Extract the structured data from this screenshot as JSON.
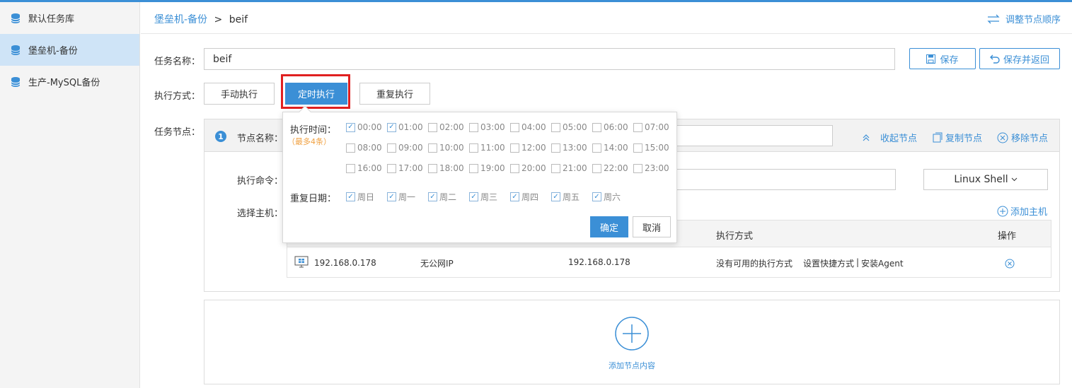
{
  "sidebar": {
    "items": [
      {
        "label": "默认任务库",
        "icon": "database-icon"
      },
      {
        "label": "堡垒机-备份",
        "icon": "database-icon"
      },
      {
        "label": "生产-MySQL备份",
        "icon": "database-icon"
      }
    ]
  },
  "breadcrumb": {
    "parent": "堡垒机-备份",
    "sep": ">",
    "current": "beif"
  },
  "adjust_order": "调整节点顺序",
  "form": {
    "name_label": "任务名称：",
    "name_value": "beif",
    "save": "保存",
    "save_back": "保存并返回",
    "mode_label": "执行方式：",
    "modes": [
      "手动执行",
      "定时执行",
      "重复执行"
    ],
    "selected_mode": "定时执行",
    "node_label": "任务节点："
  },
  "node": {
    "index": "1",
    "name_label": "节点名称：",
    "collapse": "收起节点",
    "copy": "复制节点",
    "remove": "移除节点",
    "cmd_label": "执行命令：",
    "shell": "Linux Shell",
    "host_label": "选择主机：",
    "add_host": "添加主机",
    "table": {
      "headers": [
        "执行方式",
        "操作"
      ],
      "row": {
        "ip": "192.168.0.178",
        "public_ip": "无公网IP",
        "inner_ip": "192.168.0.178",
        "exec": "没有可用的执行方式",
        "link1": "设置快捷方式",
        "divider": "|",
        "link2": "安装Agent"
      }
    }
  },
  "add_node": "添加节点内容",
  "popup": {
    "time_label": "执行时间：",
    "limit": "（最多4条）",
    "times": [
      "00:00",
      "01:00",
      "02:00",
      "03:00",
      "04:00",
      "05:00",
      "06:00",
      "07:00",
      "08:00",
      "09:00",
      "10:00",
      "11:00",
      "12:00",
      "13:00",
      "14:00",
      "15:00",
      "16:00",
      "17:00",
      "18:00",
      "19:00",
      "20:00",
      "21:00",
      "22:00",
      "23:00"
    ],
    "checked_times": [
      "00:00",
      "01:00"
    ],
    "repeat_label": "重复日期：",
    "days": [
      "周日",
      "周一",
      "周二",
      "周三",
      "周四",
      "周五",
      "周六"
    ],
    "checked_days": [
      "周日",
      "周一",
      "周二",
      "周三",
      "周四",
      "周五",
      "周六"
    ],
    "ok": "确定",
    "cancel": "取消"
  },
  "colors": {
    "accent": "#3b8fd6",
    "highlight": "#e02020",
    "limit_text": "#f0a040"
  }
}
